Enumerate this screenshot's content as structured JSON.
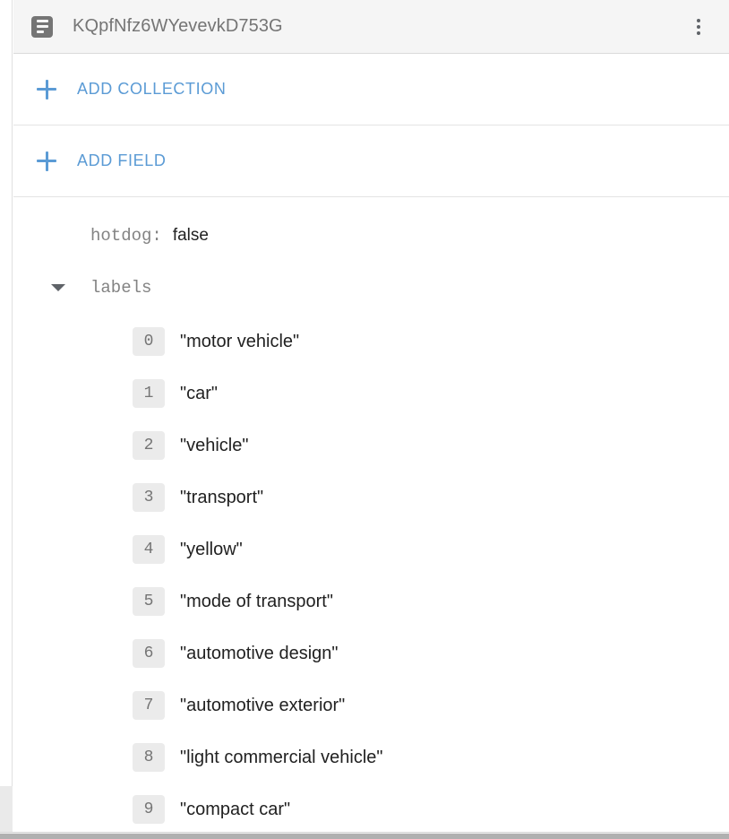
{
  "header": {
    "icon": "document-icon",
    "title": "KQpfNfz6WYevevkD753G",
    "menu_icon": "more-vert-icon"
  },
  "actions": [
    {
      "icon": "plus-icon",
      "label": "ADD COLLECTION",
      "name": "add-collection"
    },
    {
      "icon": "plus-icon",
      "label": "ADD FIELD",
      "name": "add-field"
    }
  ],
  "fields": [
    {
      "type": "boolean",
      "key": "hotdog:",
      "value": "false"
    }
  ],
  "array_field": {
    "caret_icon": "caret-down-icon",
    "key": "labels",
    "expanded": true,
    "items": [
      {
        "index": "0",
        "value": "\"motor vehicle\""
      },
      {
        "index": "1",
        "value": "\"car\""
      },
      {
        "index": "2",
        "value": "\"vehicle\""
      },
      {
        "index": "3",
        "value": "\"transport\""
      },
      {
        "index": "4",
        "value": "\"yellow\""
      },
      {
        "index": "5",
        "value": "\"mode of transport\""
      },
      {
        "index": "6",
        "value": "\"automotive design\""
      },
      {
        "index": "7",
        "value": "\"automotive exterior\""
      },
      {
        "index": "8",
        "value": "\"light commercial vehicle\""
      },
      {
        "index": "9",
        "value": "\"compact car\""
      }
    ]
  },
  "colors": {
    "accent_blue": "#5b9bd5",
    "header_bg": "#f5f5f5",
    "key_gray": "#838383",
    "value_dark": "#212121",
    "badge_bg": "#ebebeb"
  }
}
